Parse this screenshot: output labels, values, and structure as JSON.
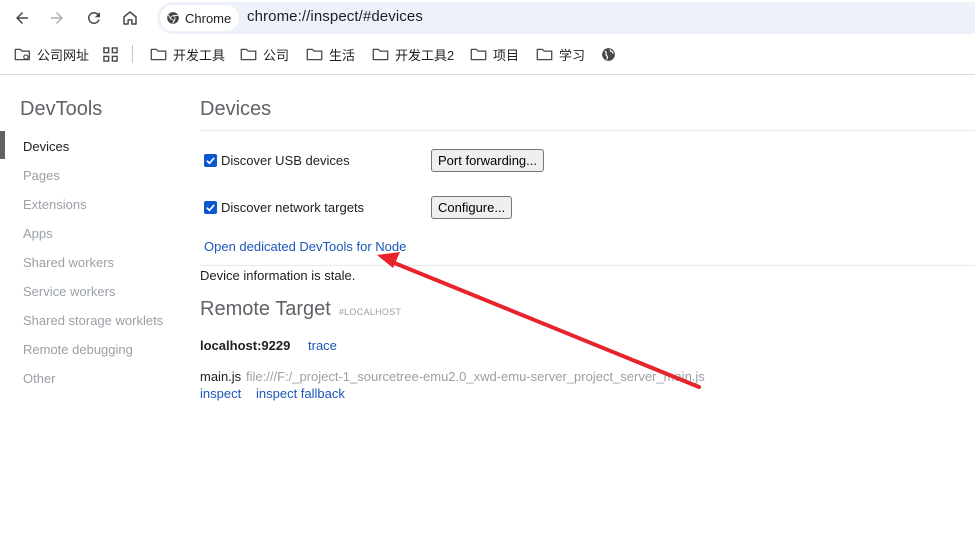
{
  "browser": {
    "chip_label": "Chrome",
    "url": "chrome://inspect/#devices"
  },
  "bookmarks": [
    {
      "label": "公司网址",
      "icon": "folder-link-icon"
    },
    {
      "label": "",
      "icon": "apps-grid-icon"
    },
    {
      "label": "开发工具",
      "icon": "folder-icon"
    },
    {
      "label": "公司",
      "icon": "folder-icon"
    },
    {
      "label": "生活",
      "icon": "folder-icon"
    },
    {
      "label": "开发工具2",
      "icon": "folder-icon"
    },
    {
      "label": "项目",
      "icon": "folder-icon"
    },
    {
      "label": "学习",
      "icon": "folder-icon"
    },
    {
      "label": "",
      "icon": "globe-icon"
    }
  ],
  "sidebar": {
    "title": "DevTools",
    "items": [
      {
        "label": "Devices",
        "active": true
      },
      {
        "label": "Pages"
      },
      {
        "label": "Extensions"
      },
      {
        "label": "Apps"
      },
      {
        "label": "Shared workers"
      },
      {
        "label": "Service workers"
      },
      {
        "label": "Shared storage worklets"
      },
      {
        "label": "Remote debugging"
      },
      {
        "label": "Other"
      }
    ]
  },
  "main": {
    "title": "Devices",
    "usb": {
      "label": "Discover USB devices",
      "checked": true,
      "button": "Port forwarding..."
    },
    "network": {
      "label": "Discover network targets",
      "checked": true,
      "button": "Configure..."
    },
    "node_link": "Open dedicated DevTools for Node",
    "stale_text": "Device information is stale.",
    "remote_title": "Remote Target",
    "remote_subtitle": "#LOCALHOST",
    "host": "localhost:9229",
    "host_action": "trace",
    "target": {
      "name": "main.js",
      "url": "file:///F:/_project-1_sourcetree-emu2.0_xwd-emu-server_project_server_main.js",
      "actions": [
        "inspect",
        "inspect fallback"
      ]
    }
  },
  "colors": {
    "accent": "#0b57d0",
    "link": "#1a56b8",
    "annotation_arrow": "#e8232b"
  }
}
